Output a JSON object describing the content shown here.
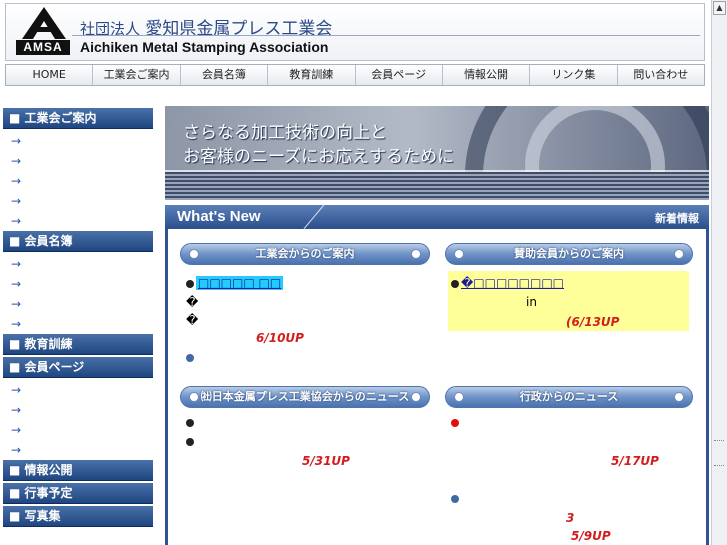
{
  "header": {
    "logo_text": "AMSA",
    "title_prefix": "社団法人",
    "title_jp": "愛知県金属プレス工業会",
    "title_en": "Aichiken Metal Stamping Association"
  },
  "nav": [
    "HOME",
    "工業会ご案内",
    "会員名簿",
    "教育訓練",
    "会員ページ",
    "情報公開",
    "リンク集",
    "問い合わせ"
  ],
  "sidebar": {
    "sections": [
      {
        "title": "■ 工業会ご案内",
        "links": [
          "→",
          "→",
          "→",
          "→",
          "→"
        ]
      },
      {
        "title": "■ 会員名簿",
        "links": [
          "→",
          "→",
          "→",
          "→"
        ]
      },
      {
        "title": "■ 教育訓練",
        "links": []
      },
      {
        "title": "■ 会員ページ",
        "links": [
          "→",
          "→",
          "→",
          "→"
        ]
      },
      {
        "title": "■ 情報公開",
        "links": []
      },
      {
        "title": "■ 行事予定",
        "links": []
      },
      {
        "title": "■ 写真集",
        "links": []
      }
    ]
  },
  "banner": {
    "line1": "さらなる加工技術の向上と",
    "line2": "お客様のニーズにお応えするために"
  },
  "whats_new": {
    "title": "What's New",
    "subtitle": "新着情報",
    "pills": {
      "association": "工業会からのご案内",
      "sponsor": "賛助会員からのご案内",
      "national": "㈳日本金属プレス工業協会からのニュース",
      "gov": "行政からのニュース"
    },
    "association_items": {
      "link": "□□□□□ □□",
      "mark1": "�",
      "mark2": "�",
      "update": "6/10UP"
    },
    "sponsor_items": {
      "link": "�□□□□□□□□",
      "in": "in",
      "update": "(6/13UP"
    },
    "national_items": {
      "update": "5/31UP"
    },
    "gov_items": {
      "update1": "5/17UP",
      "num": "3",
      "update2": "5/9UP"
    }
  },
  "colors": {
    "accent": "#2a4f8c",
    "highlight": "#22ccff",
    "update_red": "#d21e1e",
    "sponsor_bg": "#ffff99"
  }
}
